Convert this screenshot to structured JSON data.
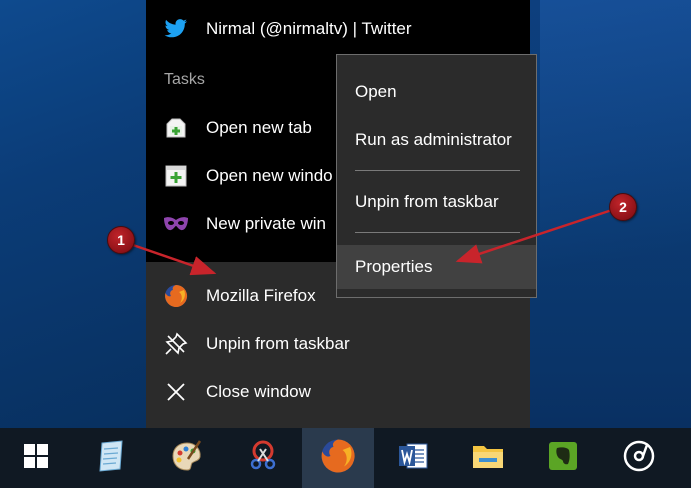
{
  "jumplist": {
    "pinned_item": {
      "label": "Nirmal (@nirmaltv) | Twitter",
      "icon": "twitter-icon"
    },
    "tasks_header": "Tasks",
    "tasks": [
      {
        "label": "Open new tab",
        "icon": "new-tab-icon"
      },
      {
        "label": "Open new windo",
        "icon": "new-window-icon"
      },
      {
        "label": "New private win",
        "icon": "private-mask-icon"
      }
    ],
    "app_items": [
      {
        "label": "Mozilla Firefox",
        "icon": "firefox-icon"
      },
      {
        "label": "Unpin from taskbar",
        "icon": "unpin-icon"
      },
      {
        "label": "Close window",
        "icon": "close-icon"
      }
    ]
  },
  "context_menu": {
    "items": [
      {
        "label": "Open"
      },
      {
        "label": "Run as administrator"
      },
      {
        "label": "Unpin from taskbar"
      },
      {
        "label": "Properties",
        "highlighted": true
      }
    ]
  },
  "annotations": {
    "badge1": "1",
    "badge2": "2",
    "color": "#b01c22"
  },
  "taskbar": {
    "buttons": [
      {
        "icon": "windows-start-icon"
      },
      {
        "icon": "notepad-icon"
      },
      {
        "icon": "paint-icon"
      },
      {
        "icon": "snipping-tool-icon"
      },
      {
        "icon": "firefox-icon",
        "active": true
      },
      {
        "icon": "word-icon"
      },
      {
        "icon": "file-explorer-icon"
      },
      {
        "icon": "evernote-icon"
      },
      {
        "icon": "groove-music-icon"
      }
    ]
  },
  "colors": {
    "menu_bg": "#2b2b2b",
    "jumplist_top_bg": "#000000",
    "taskbar_bg": "#101923",
    "twitter": "#1da1f2"
  }
}
